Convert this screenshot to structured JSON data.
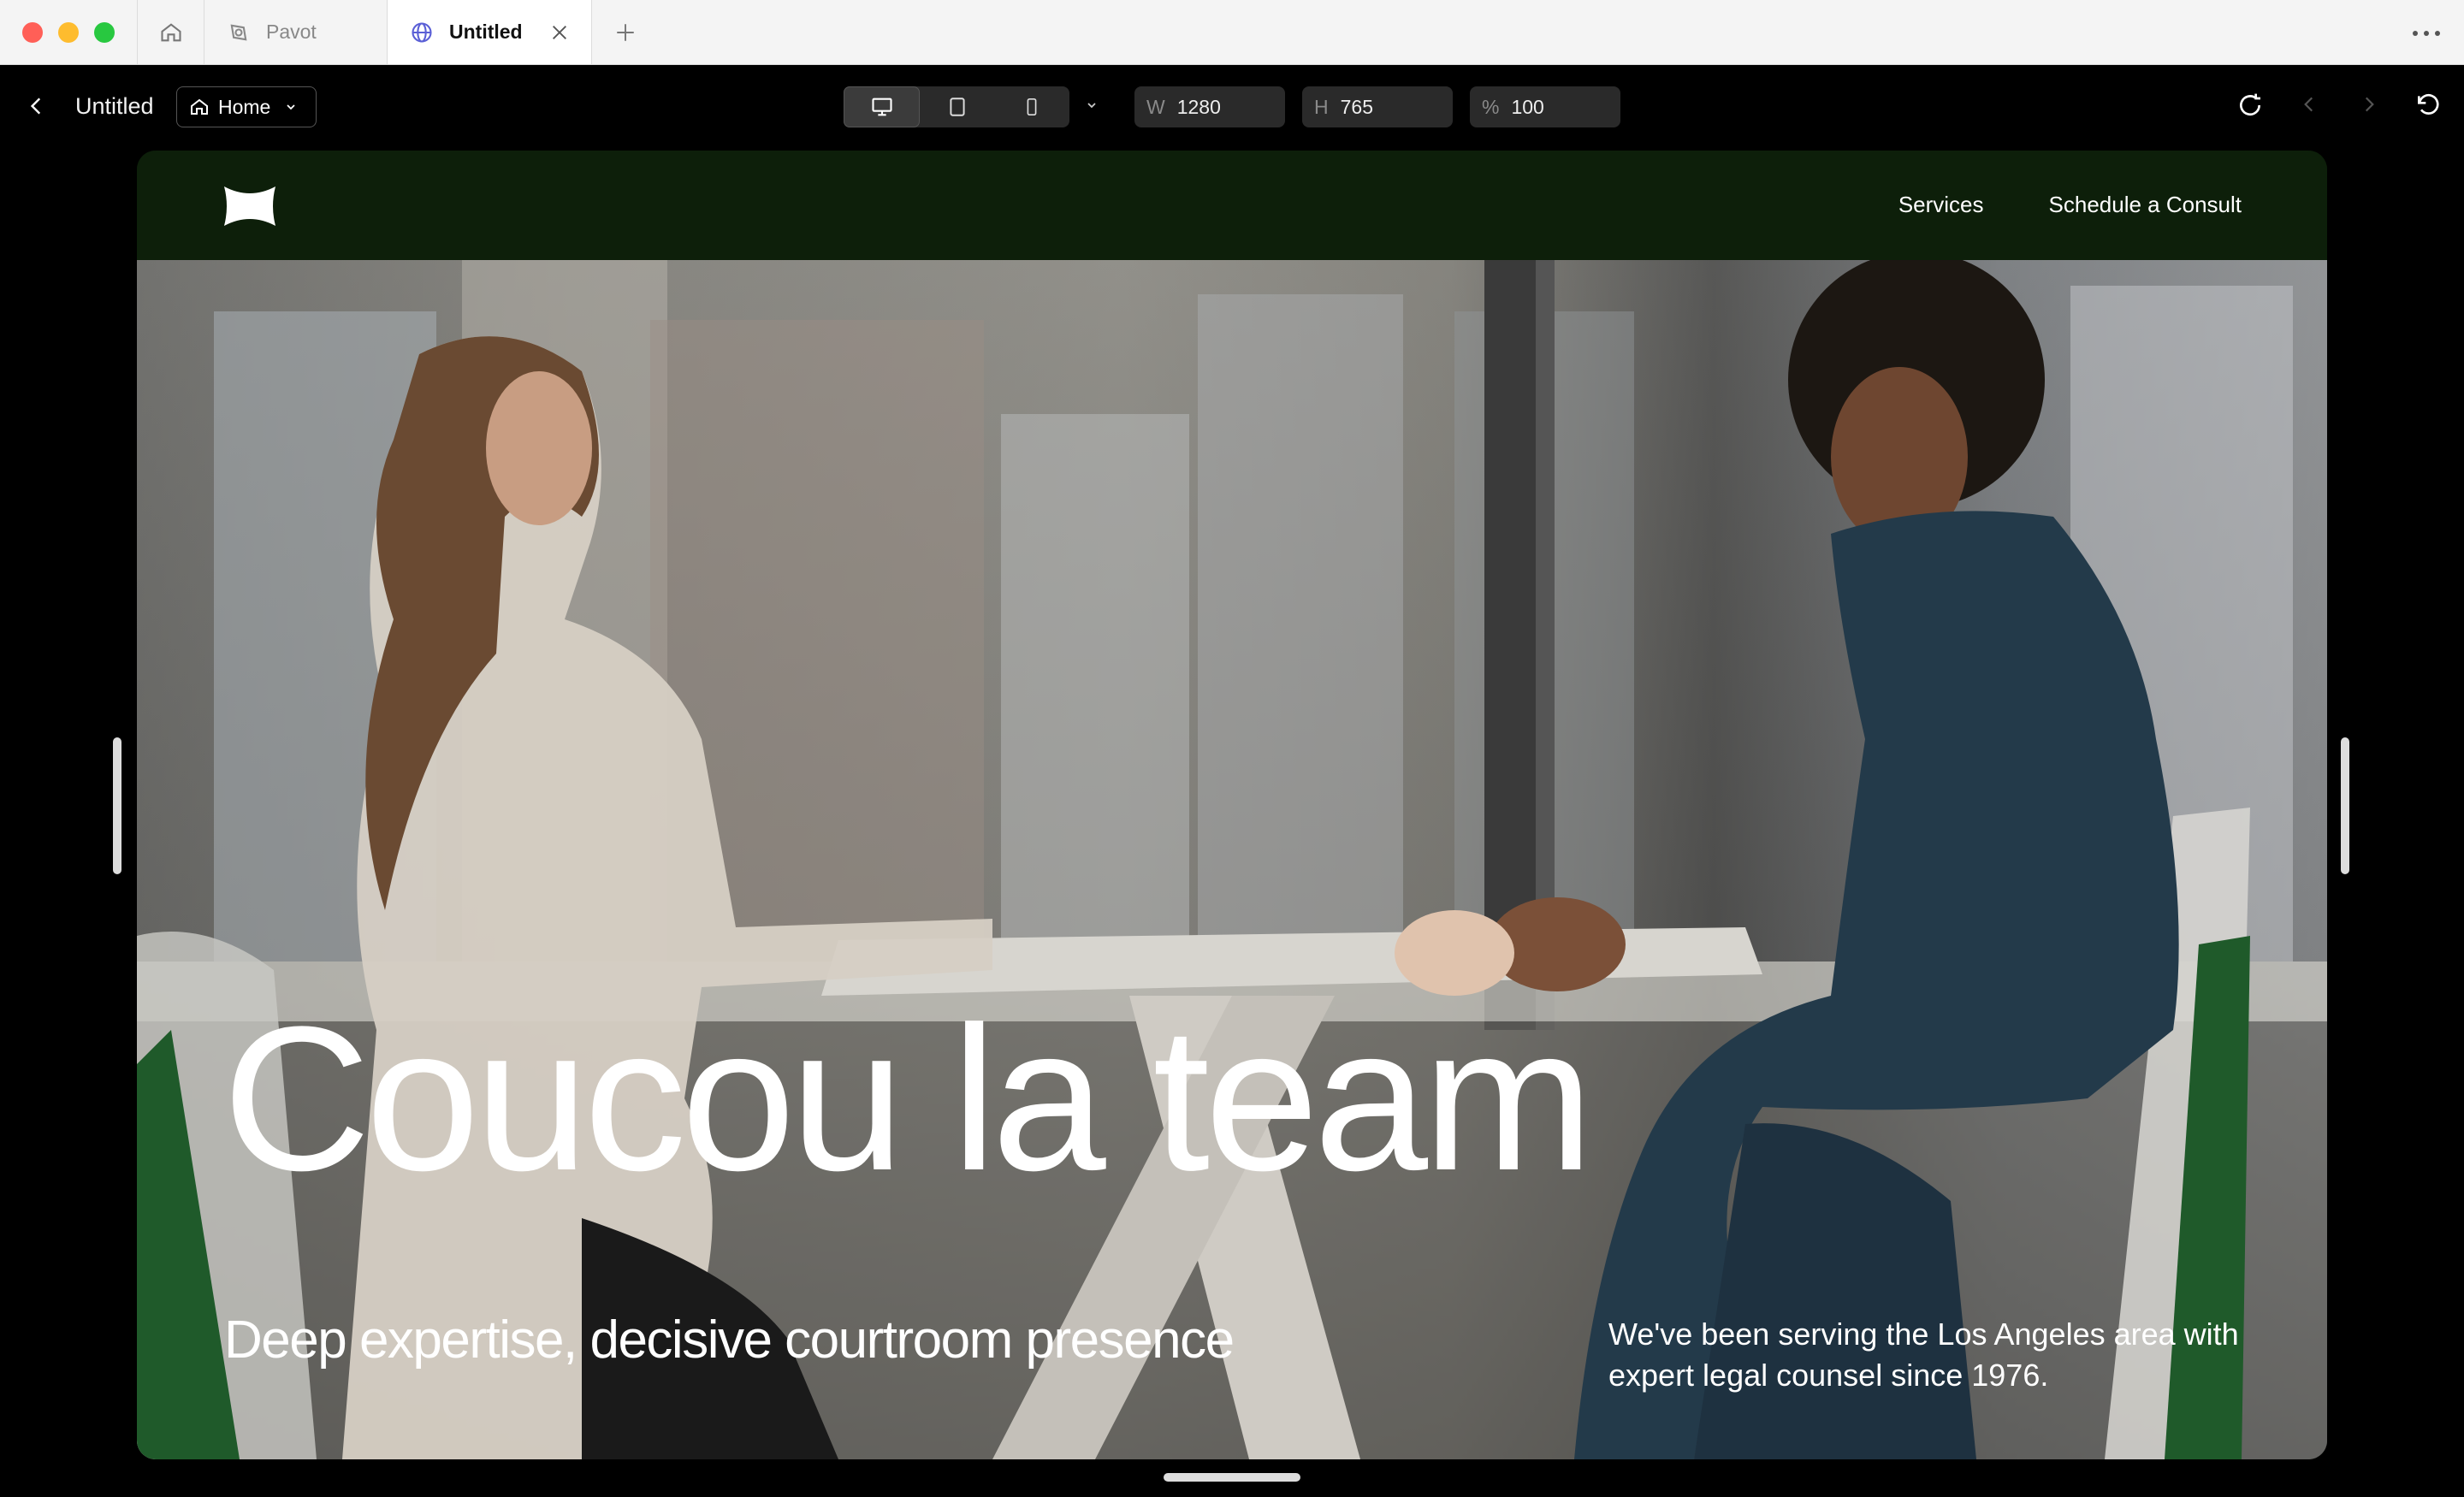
{
  "browser": {
    "tabs": [
      {
        "label": "Pavot",
        "active": false
      },
      {
        "label": "Untitled",
        "active": true
      }
    ]
  },
  "toolbar": {
    "title": "Untitled",
    "page_selector": "Home",
    "width_label": "W",
    "width_value": "1280",
    "height_label": "H",
    "height_value": "765",
    "zoom_label": "%",
    "zoom_value": "100",
    "active_device": "desktop"
  },
  "site": {
    "nav": {
      "links": [
        "Services",
        "Schedule a Consult"
      ]
    },
    "hero": {
      "title": "Coucou la team",
      "subtitle": "Deep expertise, decisive courtroom presence",
      "side_text": "We've been serving the Los Angeles area with expert legal counsel since 1976."
    }
  },
  "colors": {
    "nav_bg": "#0d1f0a",
    "chair_green": "#1f5a2a",
    "text_white": "#ffffff"
  }
}
